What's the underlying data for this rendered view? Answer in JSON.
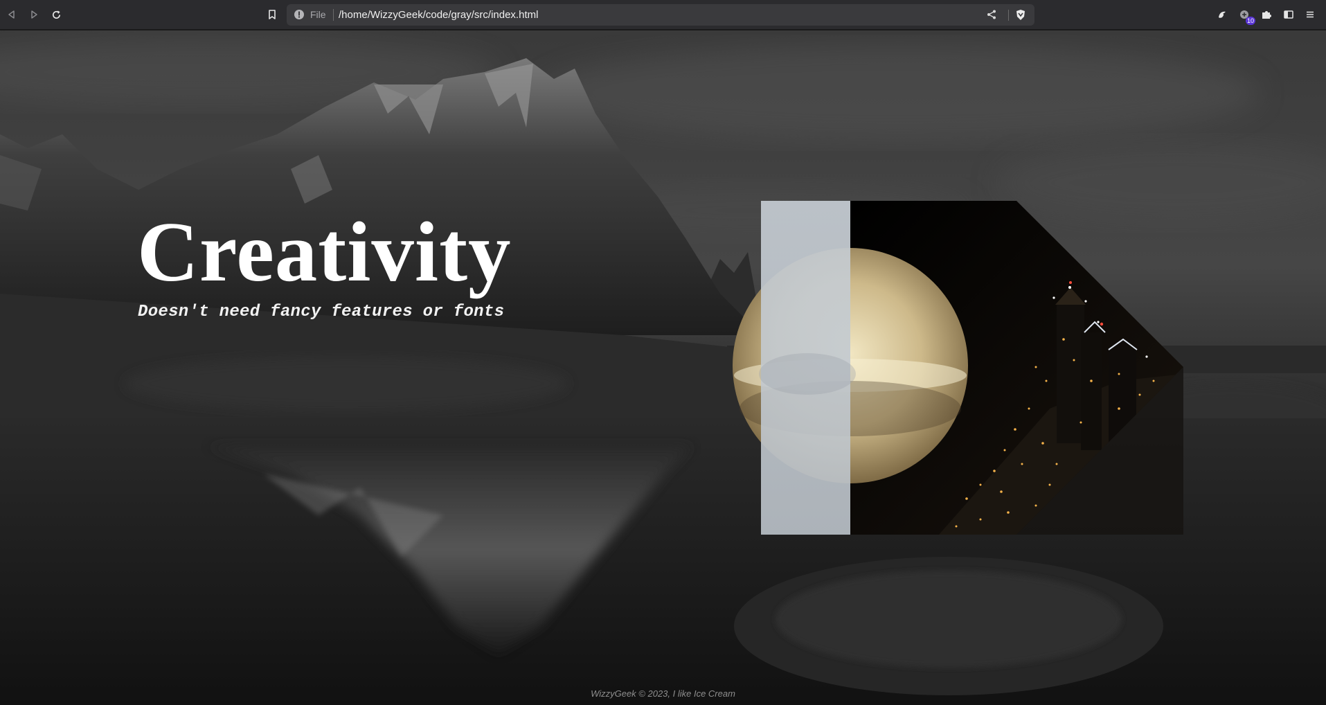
{
  "browser": {
    "url_scheme_label": "File",
    "url": "/home/WizzyGeek/code/gray/src/index.html",
    "extensions_badge": "10",
    "icons": {
      "back": "back-arrow-icon",
      "forward": "forward-arrow-icon",
      "reload": "reload-icon",
      "bookmark": "bookmark-icon",
      "site_info": "info-icon",
      "share": "share-icon",
      "shield": "brave-shield-icon",
      "rewards": "rewards-icon",
      "extension_with_badge": "extension-badge-icon",
      "extensions": "puzzle-icon",
      "sidebar": "sidebar-icon",
      "menu": "hamburger-menu-icon"
    }
  },
  "hero": {
    "title": "Creativity",
    "subtitle": "Doesn't need fancy features or fonts"
  },
  "footer": {
    "text": "WizzyGeek © 2023, I like Ice Cream"
  },
  "colors": {
    "toolbar": "#2b2b2e",
    "urlbar": "#3a3a3d",
    "title_text": "#ffffff",
    "footer_text": "#8e8e8e",
    "panel_light": "#c5ccd3",
    "sun_gold": "#e8d7a8",
    "city_lights": "#f5b24a"
  }
}
